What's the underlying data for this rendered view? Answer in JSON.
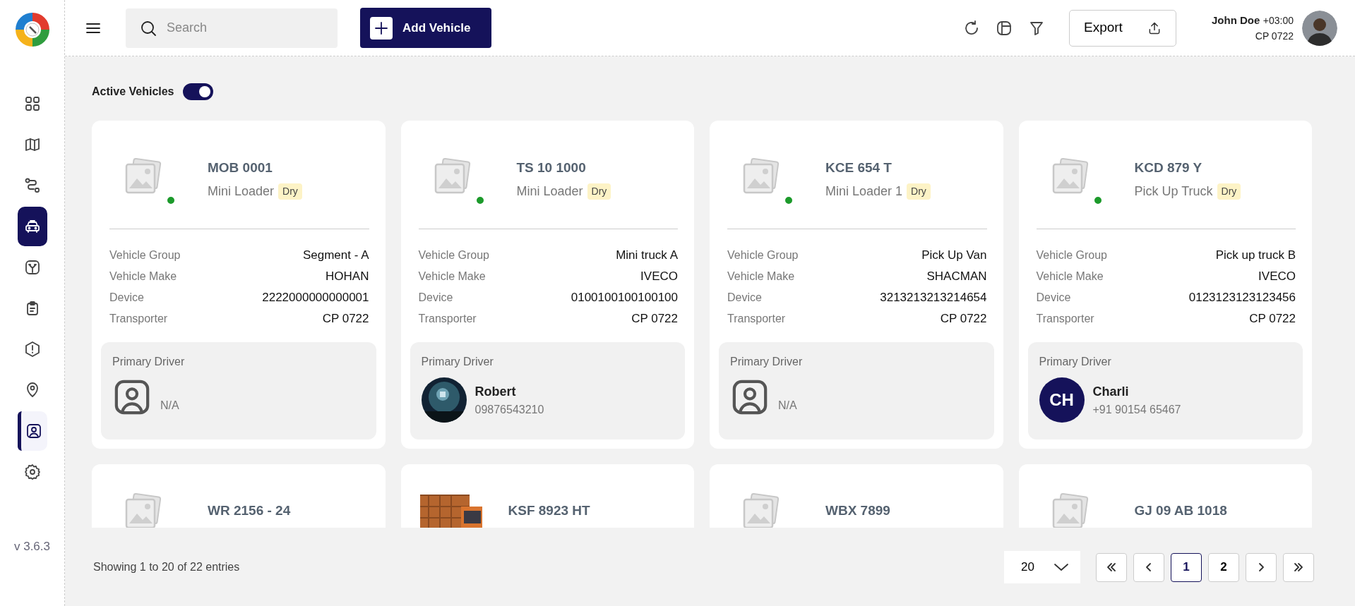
{
  "sidebar": {
    "items": [
      {
        "selected": false,
        "highlighted": false
      },
      {
        "selected": false,
        "highlighted": false
      },
      {
        "selected": false,
        "highlighted": false
      },
      {
        "selected": true,
        "highlighted": false
      },
      {
        "selected": false,
        "highlighted": false
      },
      {
        "selected": false,
        "highlighted": false
      },
      {
        "selected": false,
        "highlighted": false
      },
      {
        "selected": false,
        "highlighted": false
      },
      {
        "selected": false,
        "highlighted": true
      },
      {
        "selected": false,
        "highlighted": false
      }
    ],
    "version": "v 3.6.3"
  },
  "header": {
    "search": {
      "placeholder": "Search"
    },
    "add_button": "Add Vehicle",
    "export_button": "Export",
    "user": {
      "name": "John Doe",
      "timezone": "+03:00",
      "company": "CP 0722"
    }
  },
  "filter": {
    "label": "Active Vehicles",
    "on": true
  },
  "vehicles": [
    {
      "plate": "MOB 0001",
      "type": "Mini Loader",
      "tag": "Dry",
      "online": true,
      "details": [
        {
          "label": "Vehicle Group",
          "value": "Segment - A"
        },
        {
          "label": "Vehicle Make",
          "value": "HOHAN"
        },
        {
          "label": "Device",
          "value": "2222000000000001"
        },
        {
          "label": "Transporter",
          "value": "CP 0722"
        }
      ],
      "driver": {
        "title": "Primary Driver",
        "kind": "none",
        "text": "N/A"
      }
    },
    {
      "plate": "TS 10 1000",
      "type": "Mini Loader",
      "tag": "Dry",
      "online": true,
      "details": [
        {
          "label": "Vehicle Group",
          "value": "Mini truck A"
        },
        {
          "label": "Vehicle Make",
          "value": "IVECO"
        },
        {
          "label": "Device",
          "value": "0100100100100100"
        },
        {
          "label": "Transporter",
          "value": "CP 0722"
        }
      ],
      "driver": {
        "title": "Primary Driver",
        "name": "Robert",
        "phone": "09876543210"
      }
    },
    {
      "plate": "KCE 654 T",
      "type": "Mini Loader 1",
      "tag": "Dry",
      "online": true,
      "details": [
        {
          "label": "Vehicle Group",
          "value": "Pick Up Van"
        },
        {
          "label": "Vehicle Make",
          "value": "SHACMAN"
        },
        {
          "label": "Device",
          "value": "3213213213214654"
        },
        {
          "label": "Transporter",
          "value": "CP 0722"
        }
      ],
      "driver": {
        "title": "Primary Driver",
        "kind": "none",
        "text": "N/A"
      }
    },
    {
      "plate": "KCD 879 Y",
      "type": "Pick Up Truck",
      "tag": "Dry",
      "online": true,
      "details": [
        {
          "label": "Vehicle Group",
          "value": "Pick up truck B"
        },
        {
          "label": "Vehicle Make",
          "value": "IVECO"
        },
        {
          "label": "Device",
          "value": "0123123123123456"
        },
        {
          "label": "Transporter",
          "value": "CP 0722"
        }
      ],
      "driver": {
        "title": "Primary Driver",
        "kind": "initials",
        "initials": "CH",
        "name": "Charli",
        "phone": "+91 90154 65467"
      }
    },
    {
      "plate": "WR 2156 - 24",
      "kind": "placeholder"
    },
    {
      "plate": "KSF 8923 HT",
      "kind": "picture"
    },
    {
      "plate": "WBX 7899",
      "kind": "placeholder"
    },
    {
      "plate": "GJ 09 AB 1018",
      "kind": "placeholder"
    }
  ],
  "footer": {
    "summary": "Showing 1 to 20 of 22 entries",
    "page_size": "20",
    "pages": [
      {
        "label": "1",
        "selected": true
      },
      {
        "label": "2",
        "selected": false
      }
    ]
  }
}
